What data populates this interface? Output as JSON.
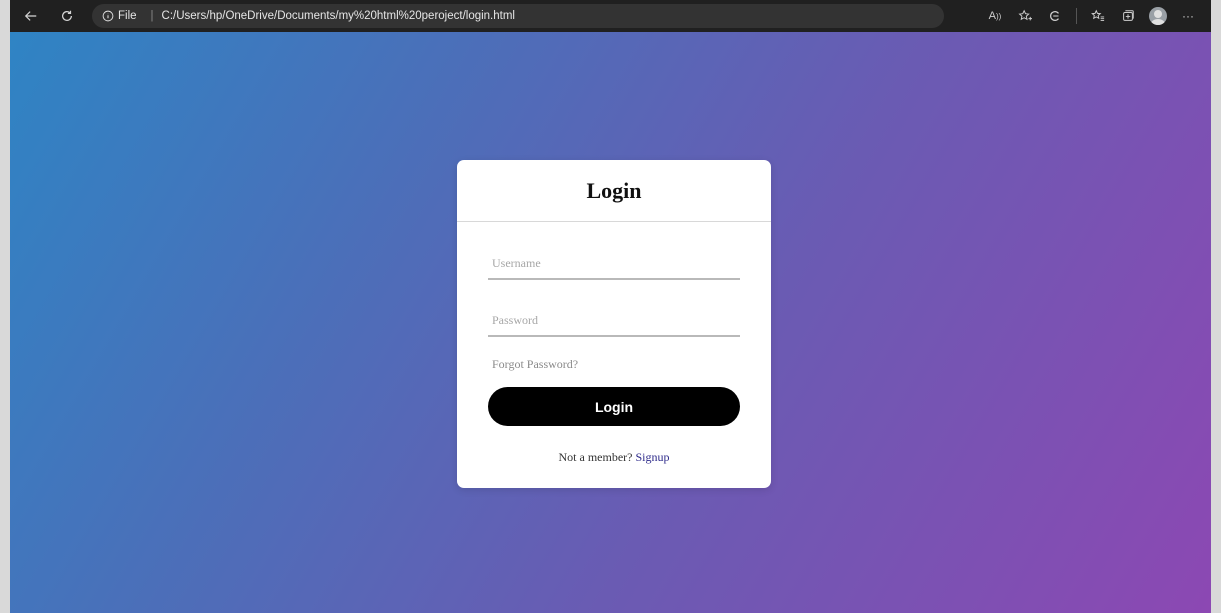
{
  "browser": {
    "address_info": "File",
    "address_url": "C:/Users/hp/OneDrive/Documents/my%20html%20peroject/login.html",
    "icons": [
      "back-icon",
      "refresh-icon",
      "info-icon",
      "read-aloud-icon",
      "favorites-add-icon",
      "extensions-icon",
      "favorites-icon",
      "collections-icon",
      "profile-avatar",
      "more-icon"
    ],
    "read_aloud_label": "A",
    "more_label": "···"
  },
  "login_card": {
    "title": "Login",
    "username_placeholder": "Username",
    "password_placeholder": "Password",
    "forgot_label": "Forgot Password?",
    "login_button_label": "Login",
    "signup_prompt": "Not a member?",
    "signup_link_label": "Signup"
  },
  "colors": {
    "gradient_start": "#2f84c4",
    "gradient_end": "#8c48b3",
    "button_bg": "#000000",
    "link": "#2d2a8a"
  }
}
